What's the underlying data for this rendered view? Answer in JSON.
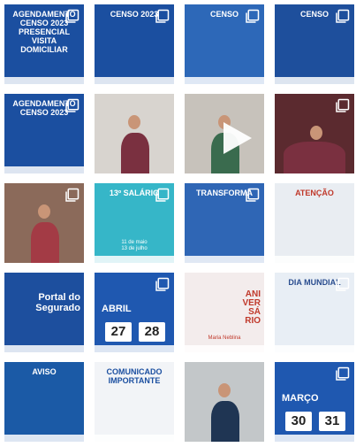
{
  "tiles": [
    {
      "title": "AGENDAMENTO\nCENSO 2023\nPRESENCIAL\nVISITA DOMICILIAR",
      "bg": "#1b4fa0",
      "fg": "#ffffff",
      "icon": "carousel"
    },
    {
      "title": "CENSO 2023",
      "body": "",
      "bg": "#1b4fa0",
      "fg": "#ffffff",
      "icon": "carousel"
    },
    {
      "title": "CENSO",
      "body": "",
      "bg": "#2d68b8",
      "fg": "#ffffff",
      "icon": "carousel"
    },
    {
      "title": "CENSO",
      "body": "",
      "bg": "#1e4f9c",
      "fg": "#ffffff",
      "icon": "carousel"
    },
    {
      "title": "AGENDAMENTO\nCENSO 2023",
      "bg": "#1b4fa0",
      "fg": "#ffffff",
      "icon": "carousel"
    },
    {
      "title": "",
      "bg": "#d8d4cf",
      "fg": "#222222",
      "icon": "none"
    },
    {
      "title": "",
      "bg": "#c7c2bb",
      "fg": "#222222",
      "icon": "play"
    },
    {
      "title": "",
      "bg": "#5b2a2f",
      "fg": "#ffffff",
      "icon": "carousel"
    },
    {
      "title": "",
      "bg": "#8b6a5a",
      "fg": "#ffffff",
      "icon": "carousel"
    },
    {
      "title": "13º SALÁRIO",
      "body": "11 de maio\n13 de julho",
      "bg": "#36b6c8",
      "fg": "#ffffff",
      "icon": "carousel"
    },
    {
      "title": "TRANSFORMA",
      "bg": "#2f66b5",
      "fg": "#ffffff",
      "icon": "carousel"
    },
    {
      "title": "ATENÇÃO",
      "bg": "#e9edf2",
      "fg": "#c0392b",
      "icon": "none"
    },
    {
      "title": "Portal do\nSegurado",
      "bg": "#1d4f9e",
      "fg": "#ffffff",
      "icon": "none"
    },
    {
      "title": "ABRIL",
      "dates": [
        "27",
        "28"
      ],
      "bg": "#1f58b0",
      "fg": "#ffffff",
      "icon": "carousel"
    },
    {
      "title": "ANI\nVER\nSÁ\nRIO",
      "body": "Maria Neblina",
      "bg": "#f3ecec",
      "fg": "#c0392b",
      "icon": "none"
    },
    {
      "title": "DIA MUNDIAL",
      "bg": "#e8eef5",
      "fg": "#2a4d8f",
      "icon": "carousel"
    },
    {
      "title": "AVISO",
      "bg": "#1b5aa6",
      "fg": "#ffffff",
      "icon": "none"
    },
    {
      "title": "COMUNICADO\nIMPORTANTE",
      "bg": "#f2f4f7",
      "fg": "#1b4fa0",
      "icon": "none"
    },
    {
      "title": "",
      "bg": "#c3c7c9",
      "fg": "#222222",
      "icon": "none"
    },
    {
      "title": "MARÇO",
      "dates": [
        "30",
        "31"
      ],
      "bg": "#1f58b0",
      "fg": "#ffffff",
      "icon": "carousel"
    }
  ]
}
